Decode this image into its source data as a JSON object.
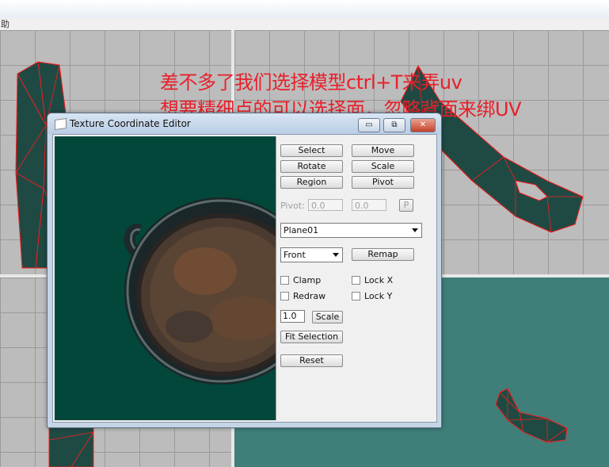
{
  "app": {
    "menu_fragment": "助"
  },
  "annotation": {
    "line1": "差不多了我们选择模型ctrl+T来弄uv",
    "line2": "想要精细点的可以选择面，忽略背面来绑UV"
  },
  "dialog": {
    "title": "Texture Coordinate Editor",
    "minimize": "▭",
    "maximize": "⧉",
    "close": "✕",
    "buttons": {
      "select": "Select",
      "move": "Move",
      "rotate": "Rotate",
      "scale": "Scale",
      "region": "Region",
      "pivot": "Pivot"
    },
    "pivot_label": "Pivot:",
    "pivot_x": "0.0",
    "pivot_y": "0.0",
    "pivot_p": "P",
    "object_select": "Plane01",
    "view_select": "Front",
    "remap": "Remap",
    "options": {
      "clamp": "Clamp",
      "lock_x": "Lock X",
      "redraw": "Redraw",
      "lock_y": "Lock Y"
    },
    "scale_value": "1.0",
    "scale_button": "Scale",
    "fit_selection": "Fit Selection",
    "reset": "Reset"
  },
  "colors": {
    "annotation": "#e8202a",
    "canvas_bg": "#02473a",
    "mesh_wire": "#ff1a1a",
    "model": "#1f4a44"
  }
}
